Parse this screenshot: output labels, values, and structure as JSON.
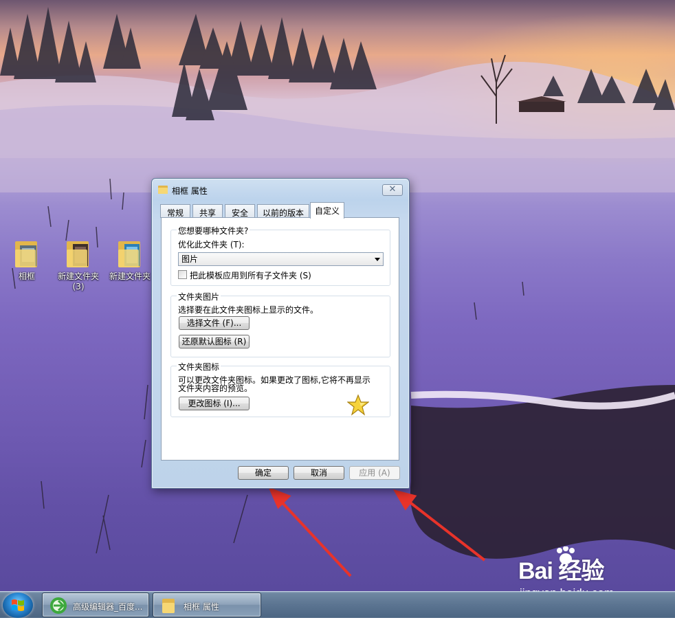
{
  "desktop": {
    "icons": [
      {
        "label": "相框"
      },
      {
        "label": "新建文件夹\n(3)"
      },
      {
        "label": "新建文件夹"
      }
    ]
  },
  "dialog": {
    "title": "相框 属性",
    "close_label": "✕",
    "tabs": [
      {
        "label": "常规"
      },
      {
        "label": "共享"
      },
      {
        "label": "安全"
      },
      {
        "label": "以前的版本"
      },
      {
        "label": "自定义",
        "active": true
      }
    ],
    "group_folder_type": {
      "title": "您想要哪种文件夹?",
      "optimize_label": "优化此文件夹 (T):",
      "selected_type": "图片",
      "apply_subfolders_label": "把此模板应用到所有子文件夹 (S)",
      "apply_subfolders_checked": false
    },
    "group_folder_pictures": {
      "title": "文件夹图片",
      "description": "选择要在此文件夹图标上显示的文件。",
      "choose_file_button": "选择文件 (F)...",
      "restore_default_button": "还原默认图标 (R)"
    },
    "group_folder_icons": {
      "title": "文件夹图标",
      "description_line1": "可以更改文件夹图标。如果更改了图标,它将不再显示",
      "description_line2": "文件夹内容的预览。",
      "change_icon_button": "更改图标 (I)..."
    },
    "buttons": {
      "ok": "确定",
      "cancel": "取消",
      "apply": "应用 (A)"
    }
  },
  "taskbar": {
    "items": [
      {
        "label": "高级编辑器_百度..."
      },
      {
        "label": "相框 属性"
      }
    ]
  },
  "watermark": {
    "brand": "Bai 经验",
    "url": "jingyan.baidu.com"
  },
  "colors": {
    "annotation_arrow": "#e8332a",
    "dialog_frame": "#c6d9ee"
  }
}
